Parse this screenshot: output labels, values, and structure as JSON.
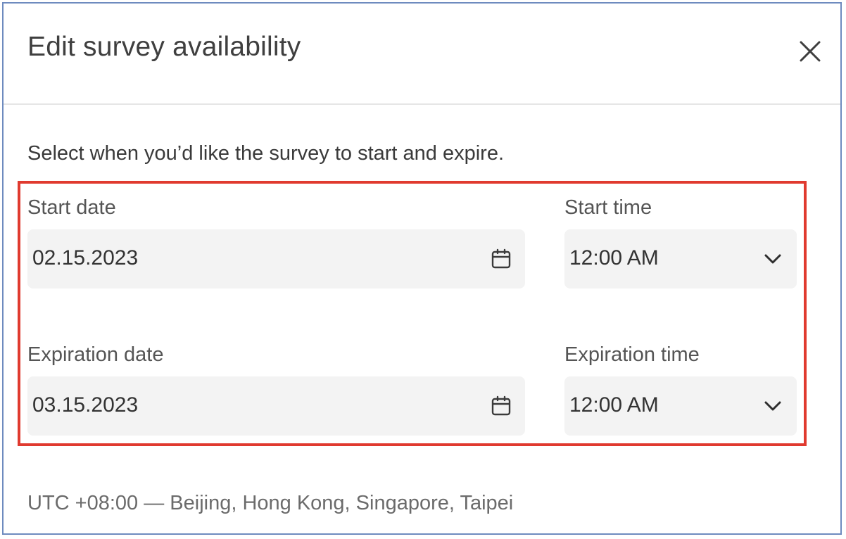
{
  "dialog": {
    "title": "Edit survey availability",
    "close_icon": "close-icon"
  },
  "instruction": "Select when you’d like the survey to start and expire.",
  "start": {
    "date_label": "Start date",
    "date_value": "02.15.2023",
    "time_label": "Start time",
    "time_value": "12:00 AM"
  },
  "expiration": {
    "date_label": "Expiration date",
    "date_value": "03.15.2023",
    "time_label": "Expiration time",
    "time_value": "12:00 AM"
  },
  "timezone": "UTC +08:00 — Beijing, Hong Kong, Singapore, Taipei",
  "icons": {
    "date": "calendar-icon",
    "time": "chevron-down-icon"
  },
  "colors": {
    "highlight": "#e03a2f",
    "field_bg": "#f3f3f3",
    "frame": "#6e8bbf"
  }
}
